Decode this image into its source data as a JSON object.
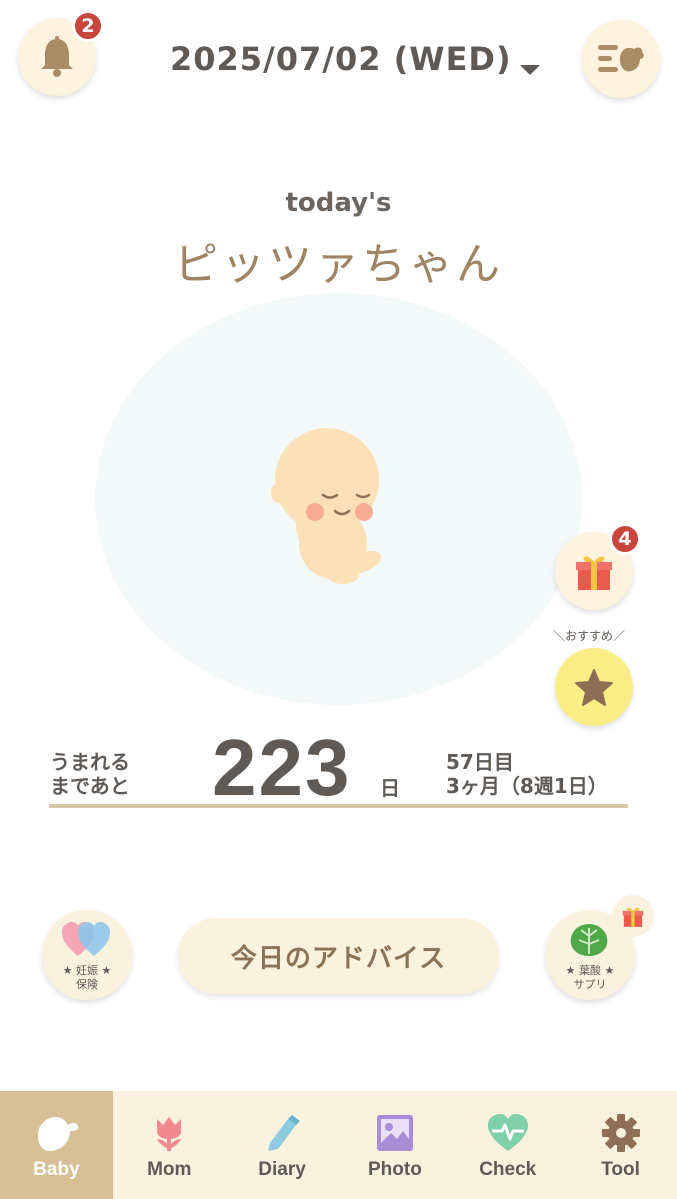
{
  "header": {
    "date": "2025/07/02 (WED)",
    "notification_count": "2"
  },
  "baby": {
    "todays_label": "today's",
    "name": "ピッツァちゃん"
  },
  "side": {
    "gift_count": "4",
    "recommend_label": "＼おすすめ／"
  },
  "countdown": {
    "label_line1": "うまれる",
    "label_line2": "まであと",
    "days": "223",
    "unit": "日",
    "elapsed_days": "57日目",
    "month_week": "3ヶ月（8週1日）"
  },
  "actions": {
    "insurance_line1": "★ 妊娠 ★",
    "insurance_line2": "保険",
    "advice_label": "今日のアドバイス",
    "supple_line1": "★ 葉酸 ★",
    "supple_line2": "サプリ"
  },
  "tabs": [
    {
      "label": "Baby",
      "icon": "bird-icon",
      "active": true
    },
    {
      "label": "Mom",
      "icon": "tulip-icon",
      "active": false
    },
    {
      "label": "Diary",
      "icon": "pencil-icon",
      "active": false
    },
    {
      "label": "Photo",
      "icon": "photo-icon",
      "active": false
    },
    {
      "label": "Check",
      "icon": "heart-pulse-icon",
      "active": false
    },
    {
      "label": "Tool",
      "icon": "gear-icon",
      "active": false
    }
  ],
  "colors": {
    "accent_beige": "#d6bf95",
    "button_cream": "#fbf1df",
    "badge_red": "#c8463e",
    "star_yellow": "#fbee87"
  }
}
